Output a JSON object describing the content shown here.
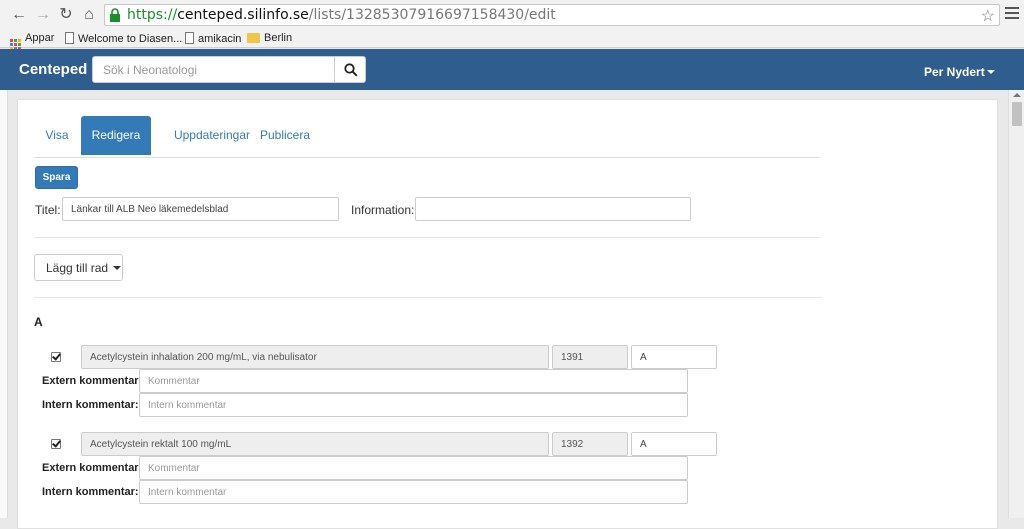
{
  "browser": {
    "url_protocol": "https://",
    "url_host": "centeped.silinfo.se",
    "url_path": "/lists/13285307916697158430/edit",
    "bookmarks": [
      {
        "label": "Appar",
        "icon": "apps-grid-icon"
      },
      {
        "label": "Welcome to Diasen...",
        "icon": "page-icon"
      },
      {
        "label": "amikacin",
        "icon": "page-icon"
      },
      {
        "label": "Berlin",
        "icon": "folder-icon"
      }
    ]
  },
  "navbar": {
    "brand": "Centeped",
    "search_placeholder": "Sök i Neonatologi",
    "user": "Per Nydert",
    "color": "#2f5d8e"
  },
  "tabs": [
    {
      "label": "Visa",
      "active": false
    },
    {
      "label": "Redigera",
      "active": true
    },
    {
      "label": "Uppdateringar",
      "active": false
    },
    {
      "label": "Publicera",
      "active": false
    }
  ],
  "form": {
    "save_label": "Spara",
    "title_label": "Titel:",
    "title_value": "Länkar till ALB Neo läkemedelsblad",
    "information_label": "Information:",
    "information_value": "",
    "add_row_label": "Lägg till rad"
  },
  "section": {
    "letter": "A",
    "rows": [
      {
        "checked": true,
        "name": "Acetylcystein inhalation 200 mg/mL, via nebulisator",
        "id": "1391",
        "group": "A",
        "extern_label": "Extern kommentar:",
        "extern_placeholder": "Kommentar",
        "intern_label": "Intern kommentar:",
        "intern_placeholder": "Intern kommentar"
      },
      {
        "checked": true,
        "name": "Acetylcystein rektalt 100 mg/mL",
        "id": "1392",
        "group": "A",
        "extern_label": "Extern kommentar:",
        "extern_placeholder": "Kommentar",
        "intern_label": "Intern kommentar:",
        "intern_placeholder": "Intern kommentar"
      }
    ]
  },
  "colors": {
    "primary": "#337ab7",
    "navbar": "#2f5d8e"
  }
}
